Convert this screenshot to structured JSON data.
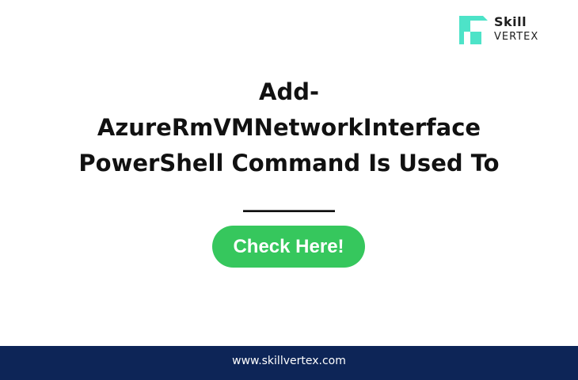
{
  "logo": {
    "line1": "Skill",
    "line2": "VERTEX",
    "mark_color": "#4de3c8",
    "icon": "skillvertex-logo-icon"
  },
  "headline": {
    "lines": [
      "Add-",
      "AzureRmVMNetworkInterface",
      "PowerShell Command Is Used To",
      "________"
    ]
  },
  "cta": {
    "label": "Check Here!",
    "color": "#36c75d"
  },
  "footer": {
    "url": "www.skillvertex.com",
    "background": "#0d2557"
  }
}
